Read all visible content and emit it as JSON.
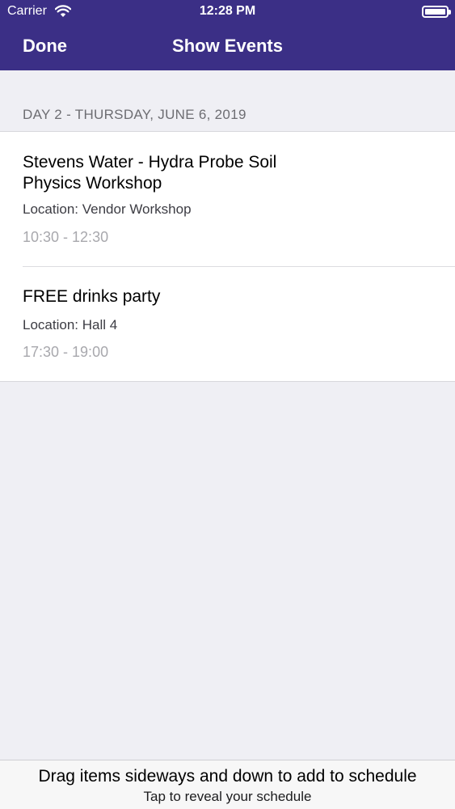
{
  "status_bar": {
    "carrier": "Carrier",
    "time": "12:28 PM",
    "icons": [
      "wifi-icon",
      "battery-icon"
    ]
  },
  "nav": {
    "done_label": "Done",
    "title": "Show Events"
  },
  "section": {
    "header": "DAY 2 - THURSDAY, JUNE 6, 2019"
  },
  "events": [
    {
      "title": "Stevens Water - Hydra Probe Soil Physics Workshop",
      "location": "Location: Vendor Workshop",
      "time": "10:30 - 12:30"
    },
    {
      "title": "FREE drinks party",
      "location": "Location: Hall 4",
      "time": "17:30 - 19:00"
    }
  ],
  "bottom_bar": {
    "instruction": "Drag items sideways and down to add to schedule",
    "hint": "Tap to reveal your schedule"
  },
  "colors": {
    "nav_background": "#3b2f86",
    "background": "#efeff4",
    "time_text": "#a8a8ad"
  }
}
